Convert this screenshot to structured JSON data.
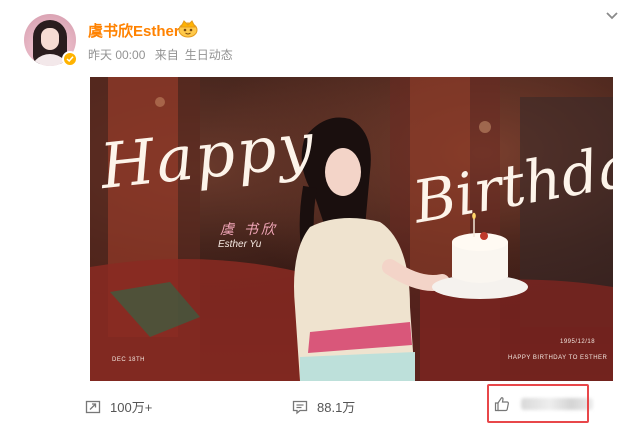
{
  "post": {
    "author": {
      "name": "虞书欣Esther",
      "verified": true
    },
    "meta": {
      "time": "昨天 00:00",
      "source_prefix": "来自",
      "source": "生日动态"
    },
    "image": {
      "happy_text": "Happy",
      "birthday_text": "Birthday",
      "name_cn": "虞 书欣",
      "name_en": "Esther Yu",
      "date_left": "DEC 18TH",
      "date_right": "1995/12/18",
      "greeting": "HAPPY BIRTHDAY TO ESTHER"
    },
    "actions": {
      "repost_count": "100万+",
      "comment_count": "88.1万"
    }
  },
  "colors": {
    "username": "#ff8200",
    "meta_text": "#939393",
    "highlight_border": "#e8474a",
    "badge": "#ffb300"
  },
  "icons": [
    "verified-badge-icon",
    "crown-icon",
    "chevron-down-icon",
    "repost-icon",
    "comment-icon",
    "like-icon"
  ]
}
